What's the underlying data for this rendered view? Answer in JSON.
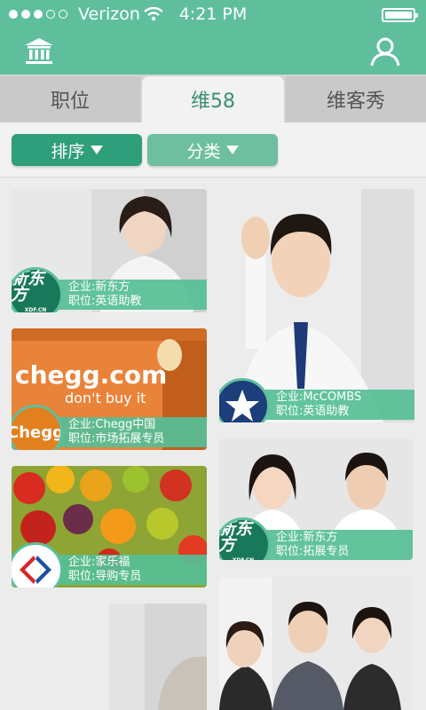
{
  "status_bar": {
    "carrier": "Verizon",
    "time": "4:21 PM"
  },
  "tabs": [
    {
      "label": "职位"
    },
    {
      "label": "维58"
    },
    {
      "label": "维客秀"
    }
  ],
  "filters": {
    "sort_label": "排序",
    "category_label": "分类"
  },
  "cards": [
    {
      "logo": "新东方",
      "logo_sub": "XDF.CN",
      "company": "企业:新东方",
      "position": "职位:英语助教"
    },
    {
      "logo": "Chegg",
      "company": "企业:Chegg中国",
      "position": "职位:市场拓展专员"
    },
    {
      "logo": "carrefour-logo",
      "company": "企业:家乐福",
      "position": "职位:导购专员"
    },
    {
      "logo": "mccombs-star-logo",
      "company": "企业:McCOMBS",
      "position": "职位:英语助教"
    },
    {
      "logo": "新东方",
      "logo_sub": "XDF.CN",
      "company": "企业:新东方",
      "position": "职位:拓展专员"
    }
  ],
  "photo_text": {
    "chegg_brand": "chegg.com",
    "chegg_slogan": "don't buy it"
  },
  "colors": {
    "brand": "#5fbf9c",
    "button": "#2f9e7a",
    "button_alt": "#6dbf9f",
    "active_tab_text": "#3a8f72"
  }
}
